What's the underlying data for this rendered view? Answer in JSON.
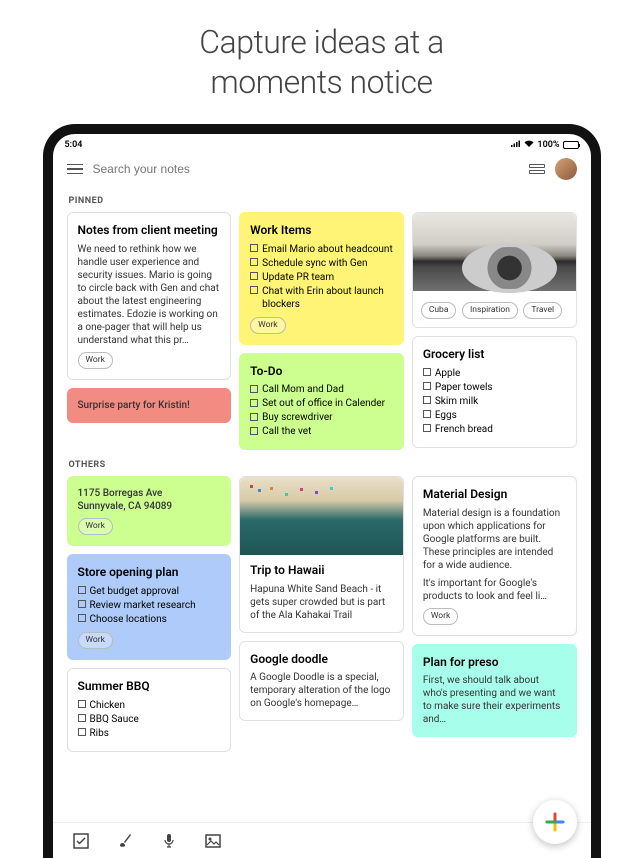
{
  "headline": "Capture ideas at a\nmoments notice",
  "status": {
    "time": "5:04",
    "battery": "100%"
  },
  "search": {
    "placeholder": "Search your notes"
  },
  "sections": {
    "pinned": "PINNED",
    "others": "OTHERS"
  },
  "pinned": {
    "client": {
      "title": "Notes from client meeting",
      "body": "We need to rethink how we handle user experience and security issues. Mario is going to circle back with Gen and chat about the latest engineering estimates. Edozie is working on a one-pager that will help us understand what this pr…",
      "chip": "Work"
    },
    "surprise": {
      "title": "Surprise party for Kristin!"
    },
    "work_items": {
      "title": "Work Items",
      "items": [
        "Email Mario about headcount",
        "Schedule sync with Gen",
        "Update PR team",
        "Chat with Erin about launch blockers"
      ],
      "chip": "Work"
    },
    "todo": {
      "title": "To-Do",
      "items": [
        "Call Mom and Dad",
        "Set out of office in Calender",
        "Buy screwdriver",
        "Call the vet"
      ]
    },
    "car": {
      "chips": [
        "Cuba",
        "Inspiration",
        "Travel"
      ]
    },
    "grocery": {
      "title": "Grocery list",
      "items": [
        "Apple",
        "Paper towels",
        "Skim milk",
        "Eggs",
        "French bread"
      ]
    }
  },
  "others": {
    "address": {
      "line1": "1175 Borregas Ave",
      "line2": "Sunnyvale, CA 94089",
      "chip": "Work"
    },
    "store": {
      "title": "Store opening plan",
      "items": [
        "Get budget approval",
        "Review market research",
        "Choose locations"
      ],
      "chip": "Work"
    },
    "bbq": {
      "title": "Summer BBQ",
      "items": [
        "Chicken",
        "BBQ Sauce",
        "Ribs"
      ]
    },
    "hawaii": {
      "title": "Trip to Hawaii",
      "body": "Hapuna White Sand Beach - it gets super crowded but is part of the Ala Kahakai Trail"
    },
    "doodle": {
      "title": "Google doodle",
      "body": "A Google Doodle is a special, temporary alteration of the logo on Google's homepage…"
    },
    "material": {
      "title": "Material Design",
      "p1": "Material design is a foundation upon which applications for Google platforms are built. These principles are intended for a wide audience.",
      "p2": "It's important for Google's products to look and feel li…",
      "chip": "Work"
    },
    "preso": {
      "title": "Plan for preso",
      "body": "First, we should talk about who's presenting and we want to make sure their experiments and…"
    }
  }
}
